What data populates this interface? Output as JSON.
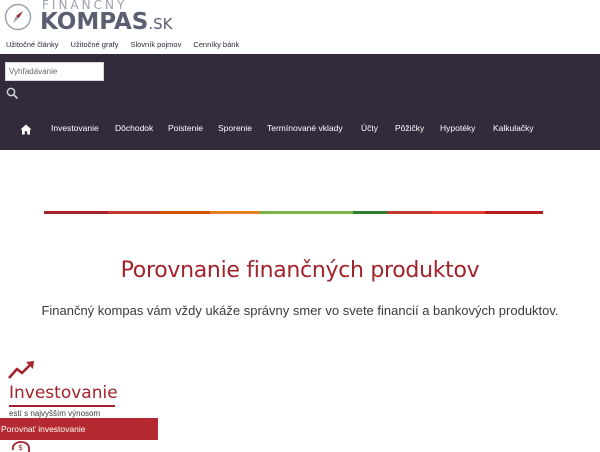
{
  "logo": {
    "top": "FINANČNÝ",
    "main": "KOMPAS",
    "suffix": ".SK"
  },
  "topnav": [
    "Užitočné články",
    "Užitočné grafy",
    "Slovník pojmov",
    "Cenníky bánk"
  ],
  "search": {
    "placeholder": "Vyhľadávanie",
    "value": ""
  },
  "menu": [
    "Investovanie",
    "Dôchodok",
    "Poistenie",
    "Sporenie",
    "Termínované vklady",
    "Účty",
    "Pôžičky",
    "Hypotéky",
    "Kalkulačky"
  ],
  "colors": {
    "accent": "#a2232b",
    "navbar": "#332a3c",
    "button": "#b52930"
  },
  "hero": {
    "title": "Porovnanie finančných produktov",
    "subtitle": "Finančný kompas vám vždy ukáže správny smer vo svete financií a bankových produktov."
  },
  "investovanie": {
    "title": "Investovanie",
    "desc": "estí s najvyšším výnosom",
    "button": "Porovnať investovanie"
  },
  "icons": [
    "compass-icon",
    "search-icon",
    "home-icon",
    "trend-up-icon",
    "piggy-bank-icon"
  ]
}
